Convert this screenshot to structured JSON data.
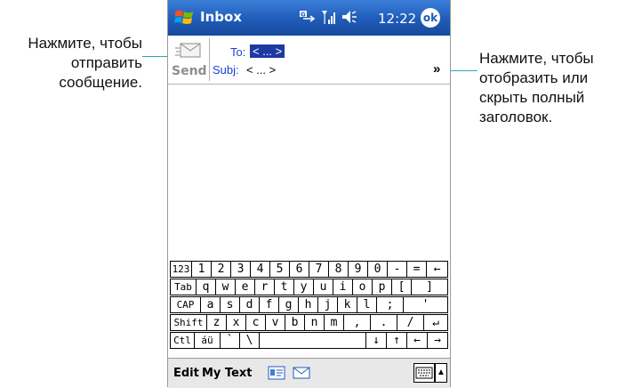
{
  "callouts": {
    "left": [
      "Нажмите, чтобы",
      "отправить",
      "сообщение."
    ],
    "right": [
      "Нажмите, чтобы",
      "отобразить или",
      "скрыть полный",
      "заголовок."
    ]
  },
  "titlebar": {
    "title": "Inbox",
    "time": "12:22",
    "ok_label": "ok"
  },
  "header": {
    "send_label": "Send",
    "to_label": "To:",
    "to_value": "< ... >",
    "subj_label": "Subj:",
    "subj_value": "< ... >",
    "expand_glyph": "»"
  },
  "keyboard": {
    "rows": [
      [
        "123",
        "1",
        "2",
        "3",
        "4",
        "5",
        "6",
        "7",
        "8",
        "9",
        "0",
        "-",
        "=",
        "←"
      ],
      [
        "Tab",
        "q",
        "w",
        "e",
        "r",
        "t",
        "y",
        "u",
        "i",
        "o",
        "p",
        "[",
        "]"
      ],
      [
        "CAP",
        "a",
        "s",
        "d",
        "f",
        "g",
        "h",
        "j",
        "k",
        "l",
        ";",
        "'"
      ],
      [
        "Shift",
        "z",
        "x",
        "c",
        "v",
        "b",
        "n",
        "m",
        ",",
        ".",
        "/",
        "↵"
      ],
      [
        "Ctl",
        "áü",
        "`",
        "\\",
        "",
        "↓",
        "↑",
        "←",
        "→"
      ]
    ]
  },
  "menubar": {
    "edit": "Edit",
    "my_text": "My Text"
  }
}
